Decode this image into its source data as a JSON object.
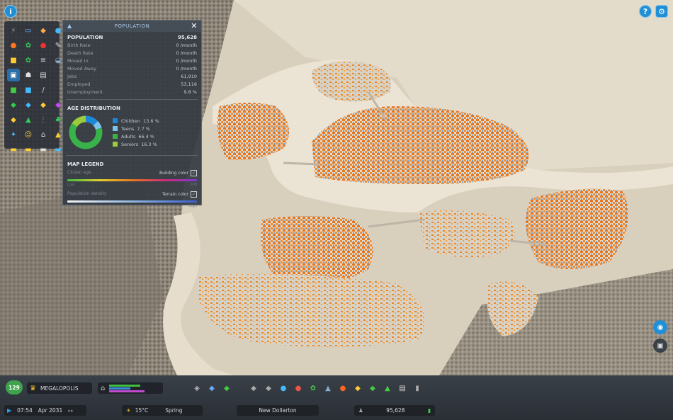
{
  "top_icons": {
    "info_glyph": "i",
    "help_glyph": "?",
    "settings_glyph": "⚙"
  },
  "panel": {
    "title": "POPULATION",
    "close_glyph": "✕",
    "population_label": "POPULATION",
    "population_value": "95,628",
    "stats": [
      {
        "label": "Birth Rate",
        "value": "0 /month"
      },
      {
        "label": "Death Rate",
        "value": "0 /month"
      },
      {
        "label": "Moved In",
        "value": "0 /month"
      },
      {
        "label": "Moved Away",
        "value": "0 /month"
      },
      {
        "label": "Jobs",
        "value": "61,910"
      },
      {
        "label": "Employed",
        "value": "53,116"
      },
      {
        "label": "Unemployment",
        "value": "9.8 %"
      }
    ],
    "age_title": "AGE DISTRIBUTION",
    "age": [
      {
        "label": "Children",
        "value": "13.6 %",
        "pct": 13.6,
        "color": "#1e88d8"
      },
      {
        "label": "Teens",
        "value": "7.7 %",
        "pct": 7.7,
        "color": "#7cc3ea"
      },
      {
        "label": "Adults",
        "value": "66.4 %",
        "pct": 66.4,
        "color": "#39b24a"
      },
      {
        "label": "Seniors",
        "value": "16.3 %",
        "pct": 16.3,
        "color": "#9ccb3b"
      }
    ],
    "map_legend_title": "MAP LEGEND",
    "legend1_label": "Citizen age",
    "legend1_toggle": "Building color",
    "legend1_low": "Low",
    "legend1_high": "Old",
    "legend2_label": "Population density",
    "legend2_toggle": "Terrain color",
    "legend2_low": "Low",
    "legend2_high": "High",
    "check_glyph": "✓"
  },
  "bottom": {
    "xp_level": "129",
    "milestone": "MEGALOPOLIS",
    "time": "07:54",
    "date": "Apr 2031",
    "temperature": "15°C",
    "season": "Spring",
    "city_name": "New Dollarton",
    "population": "95,628",
    "play_glyph": "▶",
    "speed_glyph": "▸▸"
  },
  "colors": {
    "accent": "#1f8fd6",
    "panel_bg": "#343a42",
    "bar_bg": "#2a2f36"
  }
}
